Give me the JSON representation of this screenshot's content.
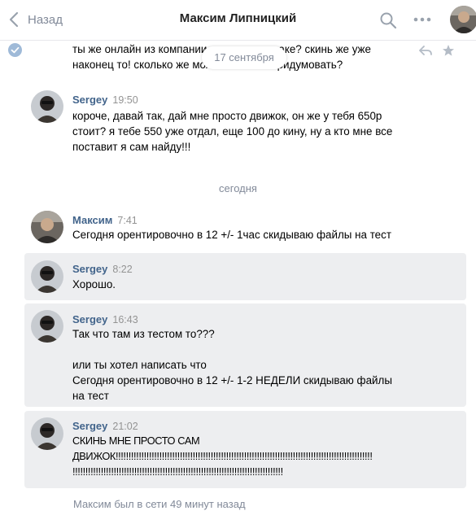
{
  "header": {
    "back_label": "Назад",
    "title": "Максим Липницкий"
  },
  "top_message": {
    "lines": "ты же онлайн из компании в сторону отдаке? скинь же уже\nнаконец то! сколько же можно отмазки придумовать?",
    "date_pill": "17 сентября"
  },
  "messages": [
    {
      "author": "Sergey",
      "time": "19:50",
      "text": "короче, давай так, дай мне просто движок, он же у тебя 650р\nстоит? я тебе 550 уже отдал, еще 100 до кину, ну а кто мне все\nпоставит я сам найду!!!"
    },
    {
      "author": "Максим",
      "time": "7:41",
      "text": "Сегодня орентировочно в 12 +/- 1час скидываю файлы на тест"
    },
    {
      "author": "Sergey",
      "time": "8:22",
      "text": "Хорошо."
    },
    {
      "author": "Sergey",
      "time": "16:43",
      "text": "Так что там из тестом то???\n\nили ты хотел написать что\nСегодня орентировочно в 12 +/- 1-2 НЕДЕЛИ скидываю файлы\nна тест"
    },
    {
      "author": "Sergey",
      "time": "21:02",
      "text": "СКИНЬ МНЕ ПРОСТО САМ\nДВИЖОК!!!!!!!!!!!!!!!!!!!!!!!!!!!!!!!!!!!!!!!!!!!!!!!!!!!!!!!!!!!!!!!!!!!!!!!!!!!!!!!!!!!!!!!!!!!!!!!!!!!!\n!!!!!!!!!!!!!!!!!!!!!!!!!!!!!!!!!!!!!!!!!!!!!!!!!!!!!!!!!!!!!!!!!!!!!!!!!!!!!!!!!!"
    }
  ],
  "date_separator": "сегодня",
  "status": "Максим был в сети 49 минут назад",
  "icons": {
    "back": "chevron-left-icon",
    "search": "search-icon",
    "more": "more-dots-icon",
    "read": "check-circle-icon",
    "reply": "reply-icon",
    "star": "star-icon"
  },
  "colors": {
    "link": "#42648b",
    "muted": "#828a99",
    "selected_bg": "#edeef0",
    "check": "#5181b8"
  }
}
